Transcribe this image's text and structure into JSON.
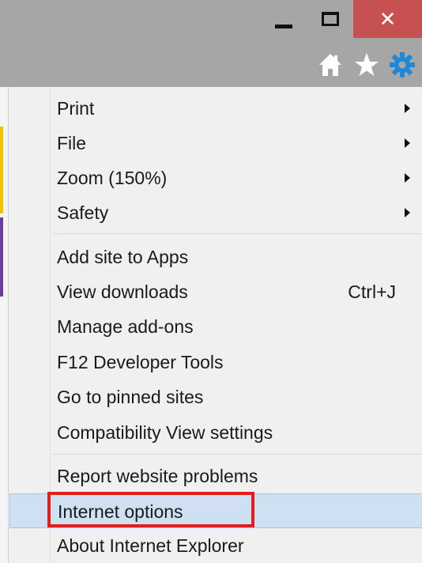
{
  "window": {
    "close_glyph": "✕",
    "icons": [
      "minimize-icon",
      "maximize-icon",
      "close-icon"
    ]
  },
  "toolbar": {
    "icons": [
      "home-icon",
      "favorites-star-icon",
      "settings-gear-icon"
    ],
    "accent": "#1e88d8"
  },
  "menu": {
    "groups": [
      [
        {
          "label": "Print",
          "submenu": true
        },
        {
          "label": "File",
          "submenu": true
        },
        {
          "label": "Zoom (150%)",
          "submenu": true
        },
        {
          "label": "Safety",
          "submenu": true
        }
      ],
      [
        {
          "label": "Add site to Apps"
        },
        {
          "label": "View downloads",
          "shortcut": "Ctrl+J"
        },
        {
          "label": "Manage add-ons"
        },
        {
          "label": "F12 Developer Tools"
        },
        {
          "label": "Go to pinned sites"
        },
        {
          "label": "Compatibility View settings"
        }
      ],
      [
        {
          "label": "Report website problems"
        },
        {
          "label": "Internet options",
          "highlighted": true
        },
        {
          "label": "About Internet Explorer"
        }
      ]
    ]
  },
  "colors": {
    "highlight_border": "#e01e1e",
    "hover_bg": "#cfe0f2",
    "close_bg": "#c75050",
    "chrome_bg": "#a6a6a6"
  }
}
